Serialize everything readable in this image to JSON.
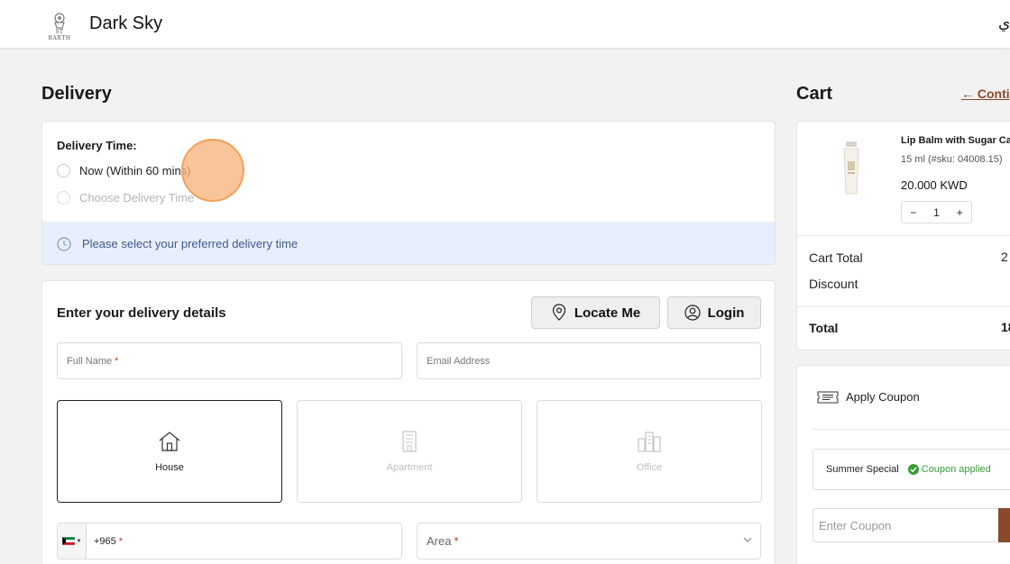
{
  "header": {
    "logo_text": "ST BARTH",
    "brand": "Dark Sky",
    "language_toggle": "ي"
  },
  "delivery": {
    "heading": "Delivery",
    "time_label": "Delivery Time:",
    "options": [
      "Now (Within 60 mins)",
      "Choose Delivery Time"
    ],
    "info_message": "Please select your preferred delivery time"
  },
  "details": {
    "title": "Enter your delivery details",
    "locate_label": "Locate Me",
    "login_label": "Login",
    "full_name_placeholder": "Full Name",
    "email_placeholder": "Email Address",
    "required_mark": "*",
    "property_types": [
      "House",
      "Apartment",
      "Office"
    ],
    "selected_property": "House",
    "phone_code": "+965",
    "area_placeholder": "Area"
  },
  "cart": {
    "heading": "Cart",
    "continue_label": "← Conti",
    "product": {
      "name": "Lip Balm with Sugar Ca",
      "sku": "15 ml (#sku: 04008.15)",
      "price": "20.000 KWD",
      "qty": "1",
      "minus": "−",
      "plus": "+"
    },
    "cart_total_label": "Cart Total",
    "cart_total_value": "2",
    "discount_label": "Discount",
    "total_label": "Total",
    "total_value": "18"
  },
  "coupon": {
    "apply_label": "Apply Coupon",
    "code_name": "Summer Special",
    "status": "Coupon applied",
    "input_placeholder": "Enter Coupon"
  },
  "colors": {
    "accent": "#8a4a2a",
    "info_bg": "#e8eefb",
    "success": "#3a9b3a"
  }
}
